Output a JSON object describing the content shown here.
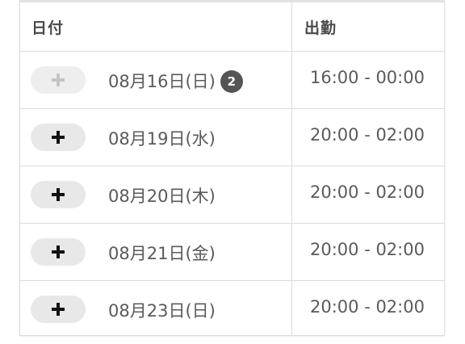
{
  "table": {
    "header": {
      "date": "日付",
      "shift": "出勤"
    },
    "rows": [
      {
        "date": "08月16日(日)",
        "badge": "2",
        "shift": "16:00 - 00:00",
        "add_enabled": false
      },
      {
        "date": "08月19日(水)",
        "badge": "",
        "shift": "20:00 - 02:00",
        "add_enabled": true
      },
      {
        "date": "08月20日(木)",
        "badge": "",
        "shift": "20:00 - 02:00",
        "add_enabled": true
      },
      {
        "date": "08月21日(金)",
        "badge": "",
        "shift": "20:00 - 02:00",
        "add_enabled": true
      },
      {
        "date": "08月23日(日)",
        "badge": "",
        "shift": "20:00 - 02:00",
        "add_enabled": true
      }
    ]
  },
  "icons": {
    "add": "plus-icon"
  },
  "colors": {
    "button_bg": "#e8e8e8",
    "plus_active": "#111111",
    "plus_disabled": "#c4c4c4",
    "badge_bg": "#555555",
    "border": "#dcdcdc"
  }
}
